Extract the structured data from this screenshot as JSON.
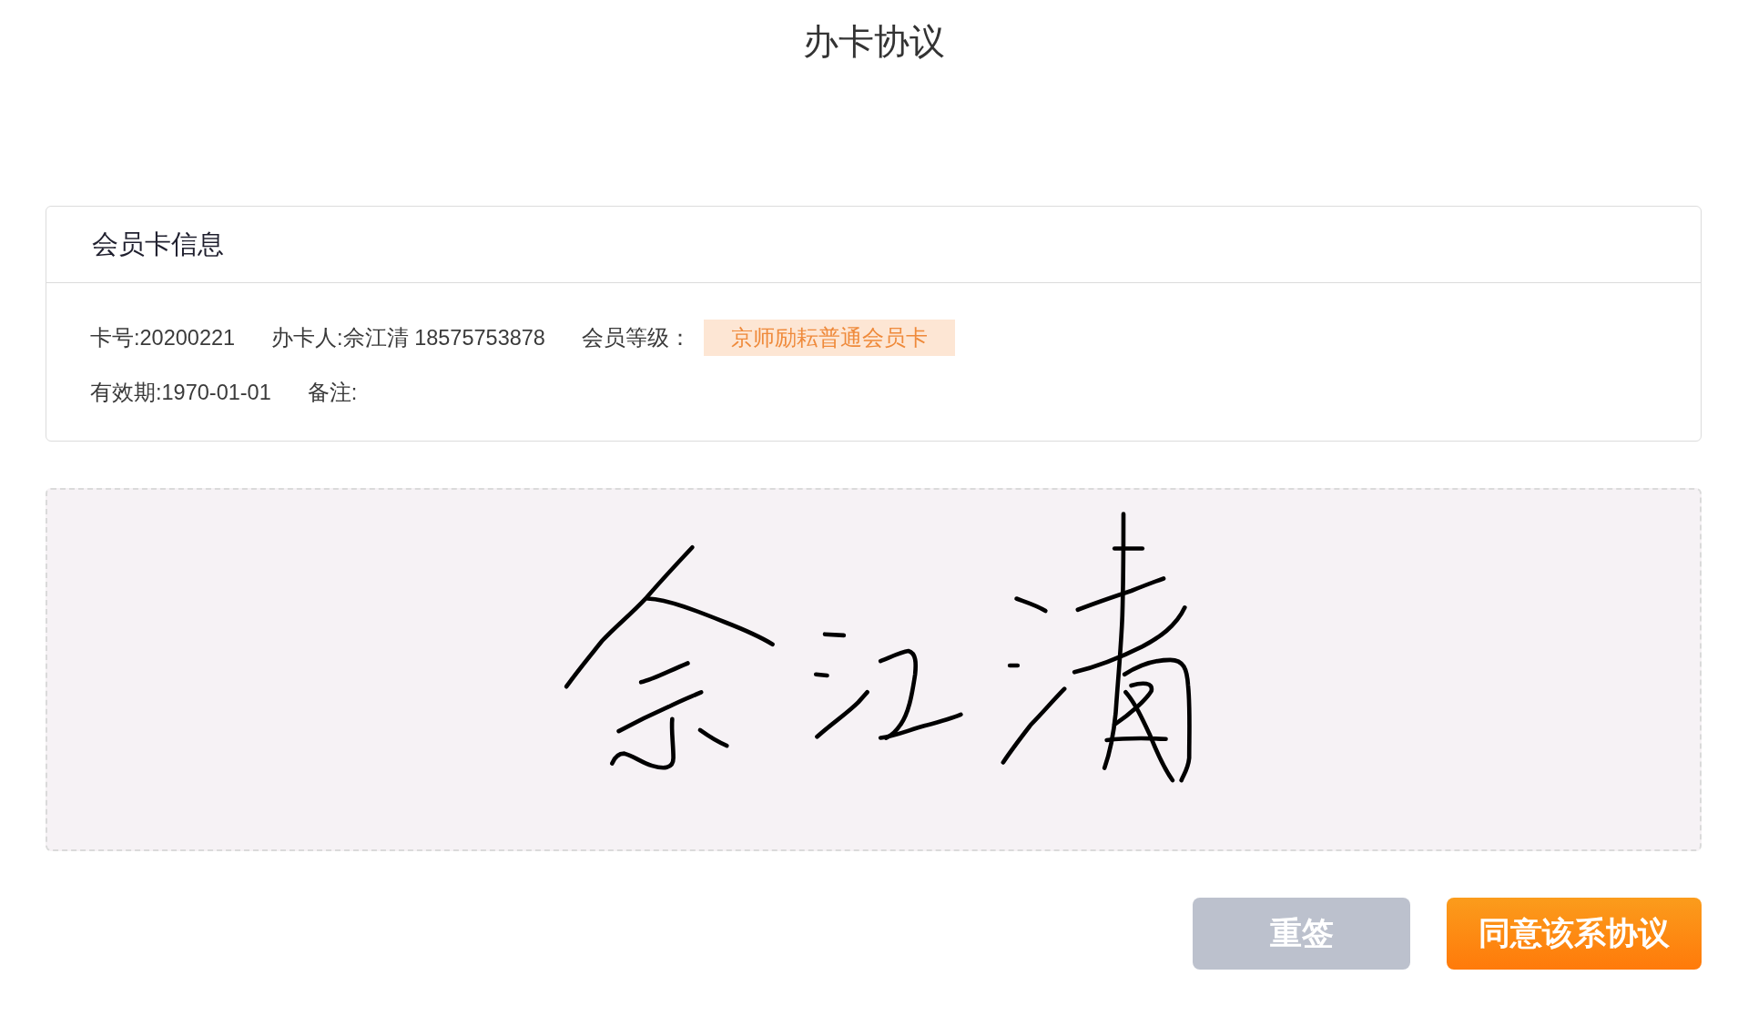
{
  "title": "办卡协议",
  "card": {
    "heading": "会员卡信息",
    "rows": [
      [
        {
          "kind": "text",
          "text": "卡号:20200221"
        },
        {
          "kind": "text",
          "text": "办卡人:佘江清 18575753878"
        },
        {
          "kind": "text",
          "text": "会员等级："
        },
        {
          "kind": "tag",
          "text": "京师励耘普通会员卡"
        }
      ],
      [
        {
          "kind": "text",
          "text": "有效期:1970-01-01"
        },
        {
          "kind": "text",
          "text": "备注:"
        }
      ]
    ]
  },
  "buttons": [
    {
      "kind": "secondary",
      "label": "重签"
    },
    {
      "kind": "primary",
      "label": "同意该系协议"
    }
  ]
}
